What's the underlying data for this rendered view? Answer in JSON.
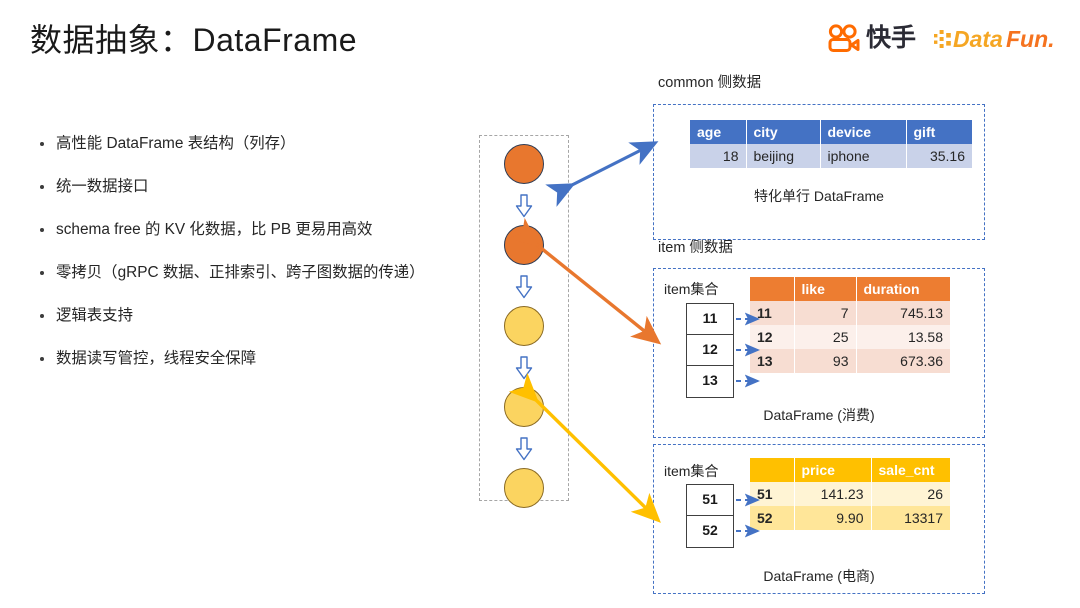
{
  "slide": {
    "title": "数据抽象：DataFrame"
  },
  "logos": {
    "kuaishou": {
      "name": "kuaishou-logo",
      "text": "快手",
      "color": "#FF6B00"
    },
    "datafun": {
      "name": "datafun-logo",
      "text": "DataFun.",
      "color": "#F5A623"
    }
  },
  "bullets": [
    "高性能 DataFrame 表结构（列存）",
    "统一数据接口",
    "schema free 的 KV 化数据，比 PB 更易用高效",
    "零拷贝（gRPC 数据、正排索引、跨子图数据的传递）",
    "逻辑表支持",
    "数据读写管控，线程安全保障"
  ],
  "pipeline": {
    "nodes": [
      {
        "label": "node-1",
        "color": "#E8772E",
        "kind": "orange"
      },
      {
        "label": "node-2",
        "color": "#E8772E",
        "kind": "orange"
      },
      {
        "label": "node-3",
        "color": "#FBD460",
        "kind": "yellow"
      },
      {
        "label": "node-4",
        "color": "#FBD460",
        "kind": "yellow"
      },
      {
        "label": "node-5",
        "color": "#FBD460",
        "kind": "yellow"
      }
    ],
    "arrow_color": "#4472C4",
    "container_border": "#A6A6A6"
  },
  "panels": {
    "common": {
      "label": "common 侧数据",
      "caption": "特化单行 DataFrame",
      "border_color": "#4472C4",
      "header_color": "#4472C4",
      "cell_color": "#C9D2E9",
      "table": {
        "headers": [
          "age",
          "city",
          "device",
          "gift"
        ],
        "rows": [
          [
            "18",
            "beijing",
            "iphone",
            "35.16"
          ]
        ]
      }
    },
    "item": {
      "label": "item 侧数据",
      "caption": "DataFrame (消费)",
      "keyset_label": "item集合",
      "keyset": [
        "11",
        "12",
        "13"
      ],
      "border_color": "#4472C4",
      "header_color": "#ED7D31",
      "table": {
        "headers": [
          "",
          "like",
          "duration"
        ],
        "rows": [
          [
            "11",
            "7",
            "745.13"
          ],
          [
            "12",
            "25",
            "13.58"
          ],
          [
            "13",
            "93",
            "673.36"
          ]
        ]
      }
    },
    "shop": {
      "caption": "DataFrame (电商)",
      "keyset_label": "item集合",
      "keyset": [
        "51",
        "52"
      ],
      "border_color": "#4472C4",
      "header_color": "#FFC000",
      "table": {
        "headers": [
          "",
          "price",
          "sale_cnt"
        ],
        "rows": [
          [
            "51",
            "141.23",
            "26"
          ],
          [
            "52",
            "9.90",
            "13317"
          ]
        ]
      }
    }
  },
  "connectors": [
    {
      "name": "common-connector",
      "color": "#4472C4"
    },
    {
      "name": "item-connector",
      "color": "#E8772E"
    },
    {
      "name": "shop-connector",
      "color": "#FFC000"
    }
  ]
}
